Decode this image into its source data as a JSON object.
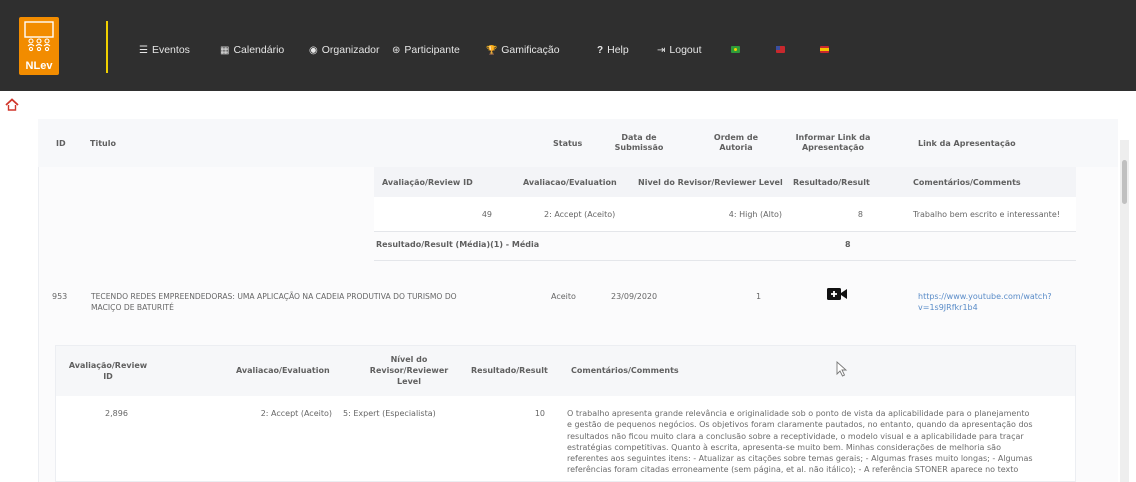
{
  "navbar": {
    "logo_text": "NLev",
    "items": [
      {
        "icon": "list-icon",
        "glyph": "☰",
        "label": "Eventos"
      },
      {
        "icon": "calendar-icon",
        "glyph": "▦",
        "label": "Calendário"
      },
      {
        "icon": "user-circle-icon",
        "glyph": "◉",
        "label": "Organizador"
      },
      {
        "icon": "participant-icon",
        "glyph": "⊛",
        "label": "Participante"
      },
      {
        "icon": "trophy-icon",
        "glyph": "🏆",
        "label": "Gamificação"
      },
      {
        "icon": "question-icon",
        "glyph": "?",
        "label": "Help"
      },
      {
        "icon": "logout-icon",
        "glyph": "⇥",
        "label": "Logout"
      }
    ],
    "flags": [
      {
        "icon": "brazil-flag-icon",
        "color": "#2e9c3a",
        "accent": "#f5d200"
      },
      {
        "icon": "usa-flag-icon",
        "color": "#c8282d",
        "accent": "#3a4ea0"
      },
      {
        "icon": "spain-flag-icon",
        "color": "#c8282d",
        "accent": "#f5c400"
      }
    ],
    "accent": "#f28c00",
    "separator_color": "#f0d000"
  },
  "table": {
    "headers": {
      "id": "ID",
      "titulo": "Titulo",
      "status": "Status",
      "data_submissao": "Data de Submissão",
      "ordem_autoria": "Ordem de Autoria",
      "informar_link": "Informar Link da Apresentação",
      "link_apresentacao": "Link da Apresentação"
    },
    "review1": {
      "headers": {
        "review_id": "Avaliação/Review ID",
        "evaluation": "Avaliacao/Evaluation",
        "level": "Nivel do Revisor/Reviewer Level",
        "result": "Resultado/Result",
        "comments": "Comentários/Comments"
      },
      "row": {
        "review_id": "49",
        "evaluation": "2: Accept (Aceito)",
        "level": "4: High (Alto)",
        "result": "8",
        "comments": "Trabalho bem escrito e interessante!"
      },
      "average_label": "Resultado/Result (Média)(1) - Média",
      "average_value": "8"
    },
    "submission": {
      "id": "953",
      "titulo_line1": "TECENDO REDES EMPREENDEDORAS: UMA APLICAÇÃO NA CADEIA PRODUTIVA DO TURISMO DO",
      "titulo_line2": "MACIÇO DE BATURITÉ",
      "status": "Aceito",
      "data": "23/09/2020",
      "ordem": "1",
      "link_line1": "https://www.youtube.com/watch?",
      "link_line2": "v=1s9JRfkr1b4"
    },
    "review2": {
      "headers": {
        "review_id_l1": "Avaliação/Review",
        "review_id_l2": "ID",
        "evaluation": "Avaliacao/Evaluation",
        "level_l1": "Nível do",
        "level_l2": "Revisor/Reviewer",
        "level_l3": "Level",
        "result": "Resultado/Result",
        "comments": "Comentários/Comments"
      },
      "row": {
        "review_id": "2,896",
        "evaluation": "2: Accept (Aceito)",
        "level": "5: Expert (Especialista)",
        "result": "10",
        "comment_lines": [
          "O trabalho apresenta grande relevância e originalidade sob o ponto de vista da aplicabilidade para o planejamento",
          "e gestão de pequenos negócios. Os objetivos foram claramente pautados, no entanto, quando da apresentação dos",
          "resultados não ficou muito clara a conclusão sobre a receptividade, o modelo visual e a aplicabilidade para traçar",
          "estratégias competitivas. Quanto à escrita, apresenta-se muito bem. Minhas considerações de melhoria são",
          "referentes aos seguintes itens: - Atualizar as citações sobre temas gerais; - Algumas frases muito longas; - Algumas",
          "referências foram citadas erroneamente (sem página, et al. não itálico); - A referência STONER aparece no texto"
        ]
      }
    }
  }
}
